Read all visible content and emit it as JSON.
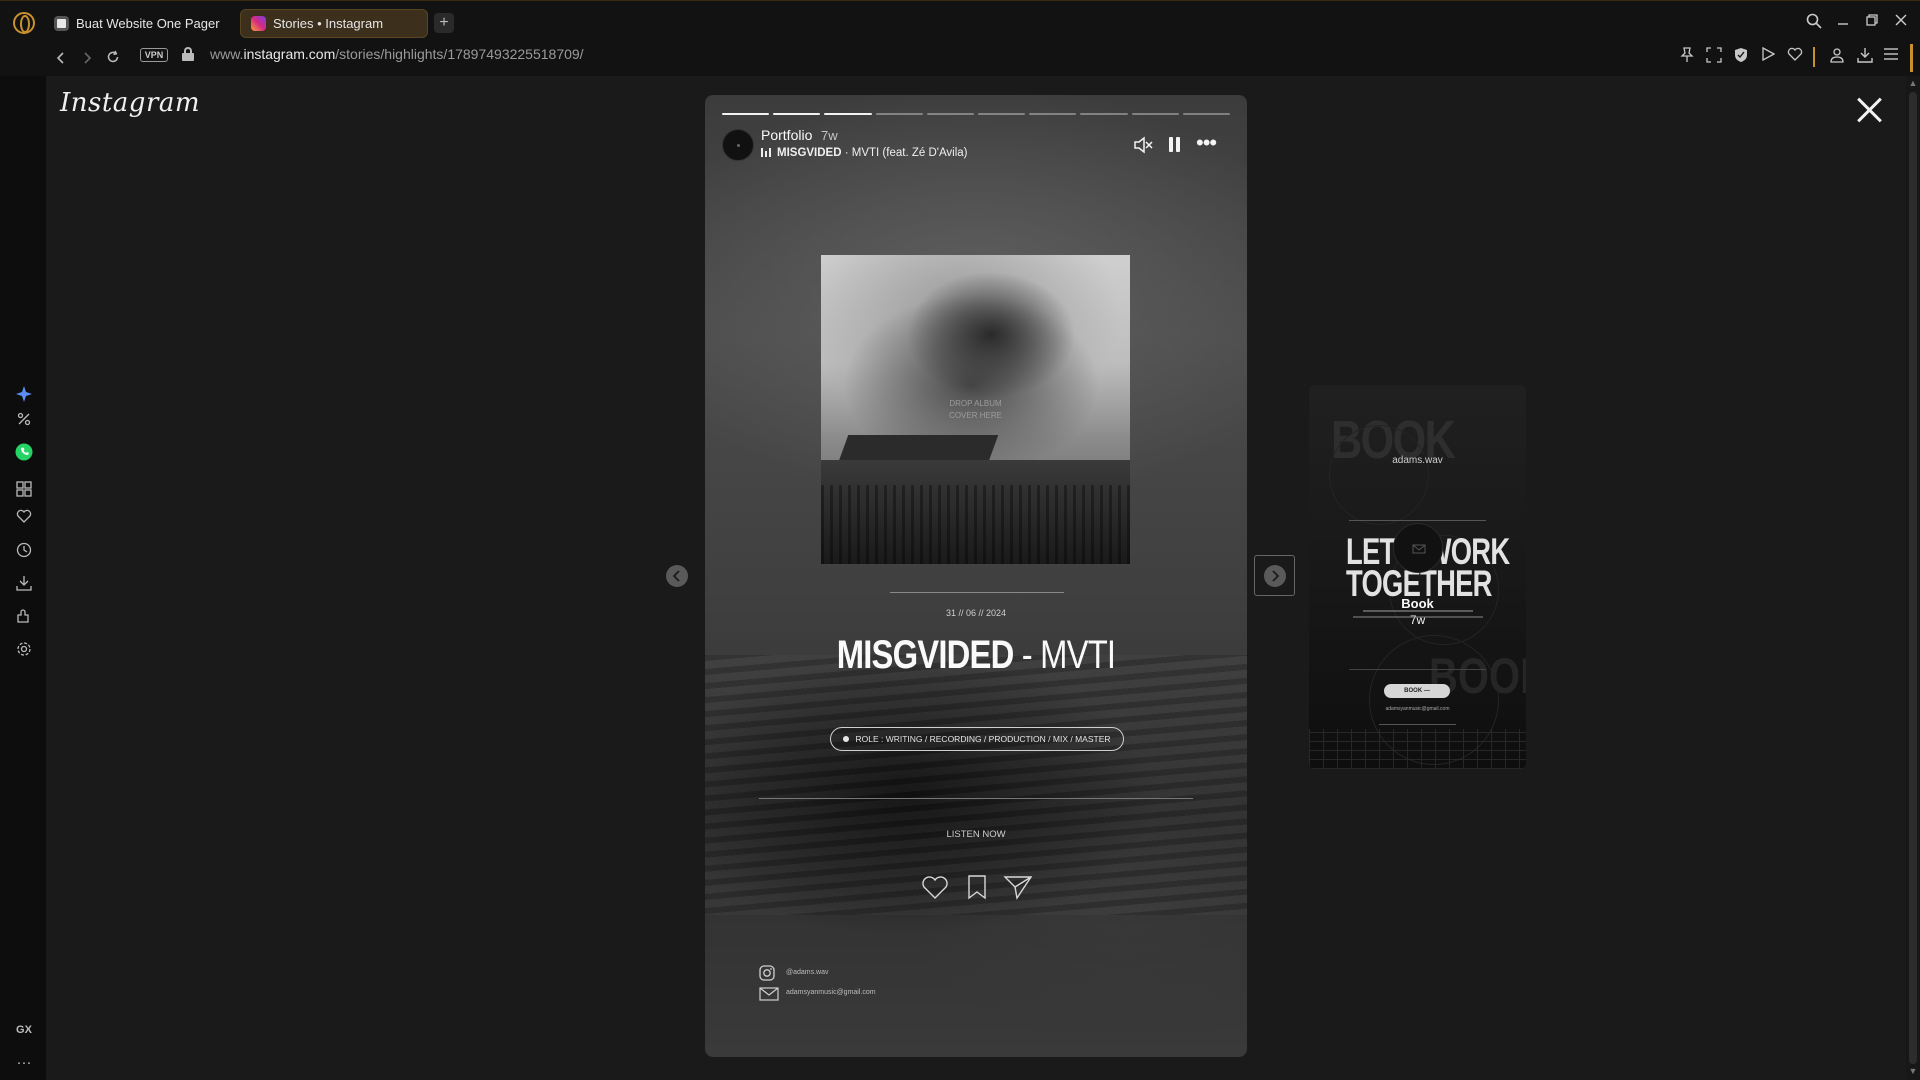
{
  "browser": {
    "tabs": [
      {
        "title": "Buat Website One Pager",
        "active": false
      },
      {
        "title": "Stories • Instagram",
        "active": true
      }
    ],
    "new_tab_glyph": "+",
    "vpn_label": "VPN",
    "url_prefix": "www.",
    "url_domain": "instagram.com",
    "url_path": "/stories/highlights/17897493225518709/",
    "accent_color": "#c9902f"
  },
  "sidebar": {
    "items": [
      "aria-icon",
      "discount-icon",
      "whatsapp-icon",
      "speed-dial-icon",
      "bookmarks-icon",
      "history-icon",
      "downloads-icon",
      "extensions-icon",
      "settings-icon"
    ],
    "gx_label": "GX",
    "more_label": "···"
  },
  "instagram": {
    "logo": "Instagram"
  },
  "story": {
    "progress_total": 10,
    "progress_done": 3,
    "username": "Portfolio",
    "time_ago": "7w",
    "music_song": "MISGVIDED",
    "music_rest": " · MVTI (feat. Zé D'Avila)",
    "album_placeholder_line1": "DROP ALBUM",
    "album_placeholder_line2": "COVER HERE",
    "release_date": "31 // 06 // 2024",
    "title_bold": "MISGVIDED",
    "title_rest": " - MVTI",
    "role": "ROLE : WRITING / RECORDING / PRODUCTION / MIX / MASTER",
    "listen_now": "LISTEN NOW",
    "contact_instagram": "@adams.wav",
    "contact_email": "adamsyanmusic@gmail.com"
  },
  "next_story": {
    "bg_word": "BOOK",
    "brand": "adams.wav",
    "headline_line1": "LET'S WORK",
    "headline_line2": "TOGETHER",
    "name": "Book",
    "time_ago": "7w",
    "button_label": "BOOK —",
    "email": "adamsyanmusic@gmail.com"
  }
}
